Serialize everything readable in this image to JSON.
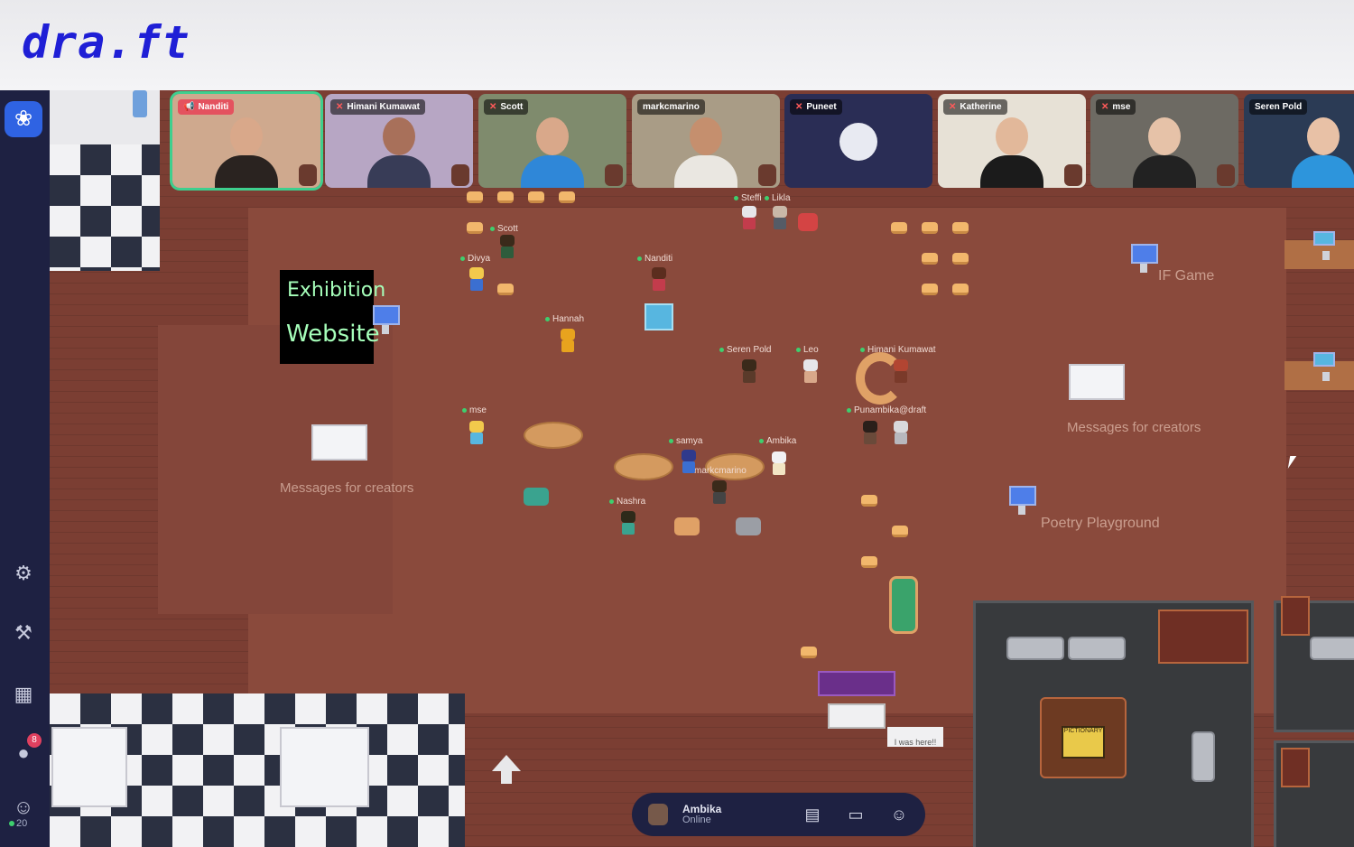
{
  "brand": {
    "title": "dra.ft"
  },
  "sidebar": {
    "online_count": "20",
    "chat_badge": "8"
  },
  "video_tiles": [
    {
      "name": "Nanditi",
      "mic": "presenting",
      "bg": "#cfa98e",
      "shirt": "#2a2320"
    },
    {
      "name": "Himani Kumawat",
      "mic": "muted",
      "bg": "#b7a6c4",
      "shirt": "#383c57"
    },
    {
      "name": "Scott",
      "mic": "muted",
      "bg": "#7f8b6d",
      "shirt": "#2f87d8"
    },
    {
      "name": "markcmarino",
      "mic": "on",
      "bg": "#a99c86",
      "shirt": "#eae7e1"
    },
    {
      "name": "Puneet",
      "mic": "muted",
      "bg": "#2a2d55",
      "shirt": ""
    },
    {
      "name": "Katherine",
      "mic": "muted",
      "bg": "#e7e1d6",
      "shirt": "#1b1b1b"
    },
    {
      "name": "mse",
      "mic": "muted",
      "bg": "#6d6a63",
      "shirt": "#222"
    },
    {
      "name": "Seren Pold",
      "mic": "on",
      "bg": "#2b3b55",
      "shirt": "#2d95dc"
    }
  ],
  "map": {
    "sign_line1": "Exhibition",
    "sign_line2": "Website",
    "labels": {
      "messages_left": "Messages for creators",
      "messages_right": "Messages for creators",
      "if_game": "IF Game",
      "poetry": "Poetry Playground",
      "was_here": "I was here!!",
      "poster": "PICTIONARY"
    },
    "players": [
      {
        "name": "Scott"
      },
      {
        "name": "Divya"
      },
      {
        "name": "Nanditi"
      },
      {
        "name": "Hannah"
      },
      {
        "name": "Steffi"
      },
      {
        "name": "Likla"
      },
      {
        "name": "Seren Pold"
      },
      {
        "name": "Leo"
      },
      {
        "name": "Himani Kumawat"
      },
      {
        "name": "Punambika@draft"
      },
      {
        "name": "mse"
      },
      {
        "name": "samya"
      },
      {
        "name": "Ambika"
      },
      {
        "name": "markcmarino"
      },
      {
        "name": "Nashra"
      }
    ]
  },
  "bottombar": {
    "user_name": "Ambika",
    "user_status": "Online"
  },
  "colors": {
    "accent": "#2f63e3",
    "brand": "#1f1fd6",
    "sidebar": "#1e2142",
    "floor": "#7b3e33",
    "online": "#3ecf6e"
  }
}
